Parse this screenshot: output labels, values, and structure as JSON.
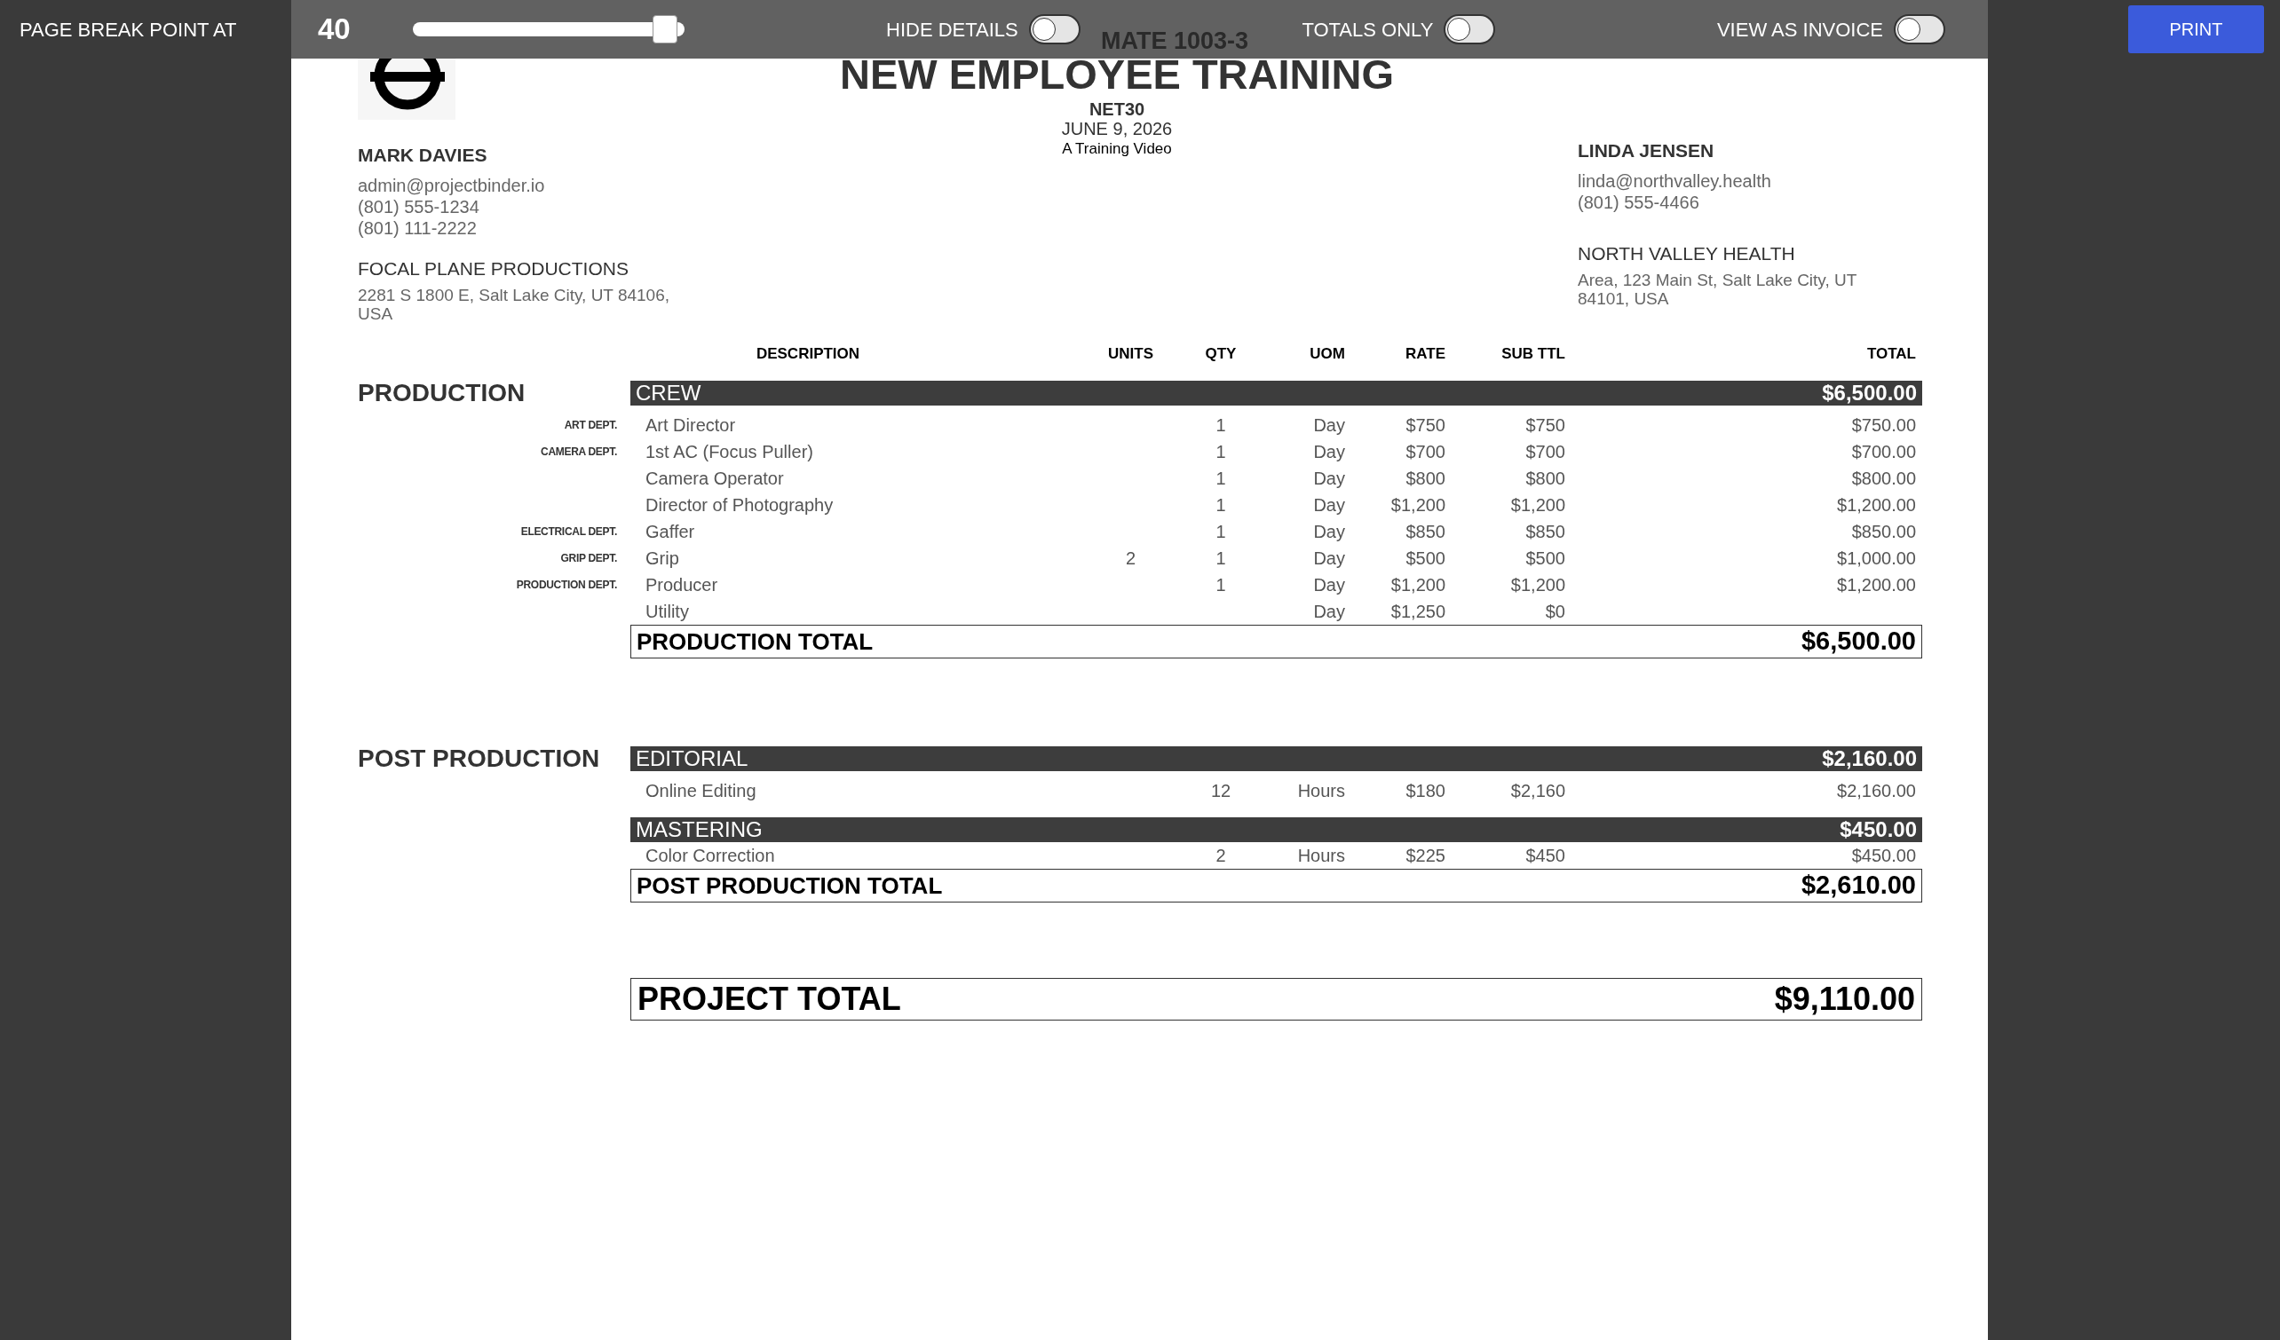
{
  "toolbar": {
    "page_break_label": "PAGE BREAK POINT AT",
    "page_break_value": "40",
    "slider": {
      "level": 0.95
    },
    "toggles": [
      {
        "label": "HIDE DETAILS",
        "on": false
      },
      {
        "label": "TOTALS ONLY",
        "on": false
      },
      {
        "label": "VIEW AS INVOICE",
        "on": false
      }
    ],
    "print_button": "PRINT"
  },
  "document": {
    "title_fragment": "MATE 1003-3",
    "title": "NEW EMPLOYEE TRAINING",
    "terms": "NET30",
    "date": "JUNE 9, 2026",
    "subtitle": "A Training Video",
    "from": {
      "name": "MARK DAVIES",
      "contact_lines": [
        "admin@projectbinder.io",
        "(801) 555-1234",
        "(801) 111-2222"
      ],
      "company": "FOCAL PLANE PRODUCTIONS",
      "address": "2281 S 1800 E, Salt Lake City, UT 84106, USA"
    },
    "to": {
      "name": "LINDA JENSEN",
      "contact_lines": [
        "linda@northvalley.health",
        "(801) 555-4466"
      ],
      "company": "NORTH VALLEY HEALTH",
      "address": "Area, 123 Main St, Salt Lake City, UT 84101, USA"
    },
    "columns": [
      "DESCRIPTION",
      "UNITS",
      "QTY",
      "UOM",
      "RATE",
      "SUB TTL",
      "TOTAL"
    ],
    "sections": [
      {
        "name": "PRODUCTION",
        "groups": [
          {
            "name": "CREW",
            "total": "$6,500.00",
            "items": [
              {
                "dept": "ART DEPT.",
                "description": "Art Director",
                "qty": "1",
                "uom": "Day",
                "rate": "$750",
                "subtotal": "$750",
                "total": "$750.00"
              },
              {
                "dept": "CAMERA DEPT.",
                "description": "1st AC (Focus Puller)",
                "qty": "1",
                "uom": "Day",
                "rate": "$700",
                "subtotal": "$700",
                "total": "$700.00"
              },
              {
                "description": "Camera Operator",
                "qty": "1",
                "uom": "Day",
                "rate": "$800",
                "subtotal": "$800",
                "total": "$800.00"
              },
              {
                "description": "Director of Photography",
                "qty": "1",
                "uom": "Day",
                "rate": "$1,200",
                "subtotal": "$1,200",
                "total": "$1,200.00"
              },
              {
                "dept": "ELECTRICAL DEPT.",
                "description": "Gaffer",
                "qty": "1",
                "uom": "Day",
                "rate": "$850",
                "subtotal": "$850",
                "total": "$850.00"
              },
              {
                "dept": "GRIP DEPT.",
                "description": "Grip",
                "units": "2",
                "qty": "1",
                "uom": "Day",
                "rate": "$500",
                "subtotal": "$500",
                "total": "$1,000.00"
              },
              {
                "dept": "PRODUCTION DEPT.",
                "description": "Producer",
                "qty": "1",
                "uom": "Day",
                "rate": "$1,200",
                "subtotal": "$1,200",
                "total": "$1,200.00"
              },
              {
                "description": "Utility",
                "uom": "Day",
                "rate": "$1,250",
                "subtotal": "$0"
              }
            ]
          }
        ],
        "total_label": "PRODUCTION TOTAL",
        "total": "$6,500.00"
      },
      {
        "name": "POST PRODUCTION",
        "groups": [
          {
            "name": "EDITORIAL",
            "total": "$2,160.00",
            "items": [
              {
                "description": "Online Editing",
                "qty": "12",
                "uom": "Hours",
                "rate": "$180",
                "subtotal": "$2,160",
                "total": "$2,160.00"
              }
            ]
          },
          {
            "name": "MASTERING",
            "total": "$450.00",
            "items": [
              {
                "description": "Color Correction",
                "qty": "2",
                "uom": "Hours",
                "rate": "$225",
                "subtotal": "$450",
                "total": "$450.00"
              }
            ]
          }
        ],
        "total_label": "POST PRODUCTION TOTAL",
        "total": "$2,610.00"
      }
    ],
    "project_total_label": "PROJECT TOTAL",
    "project_total": "$9,110.00"
  }
}
